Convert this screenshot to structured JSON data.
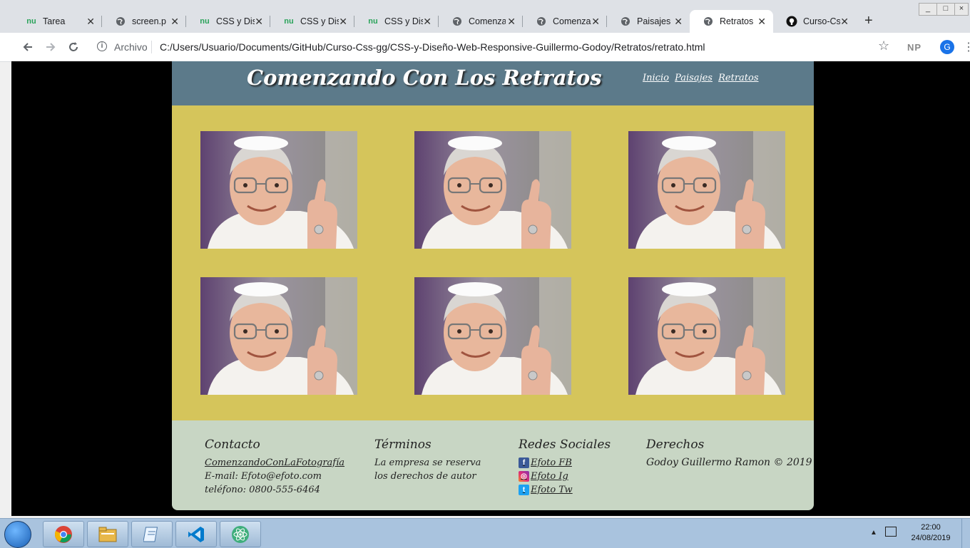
{
  "browser": {
    "tabs": [
      {
        "label": "Tarea",
        "icon": "nu-icon"
      },
      {
        "label": "screen.png",
        "icon": "globe-icon"
      },
      {
        "label": "CSS y Diseño",
        "icon": "nu-icon"
      },
      {
        "label": "CSS y Diseño",
        "icon": "nu-icon"
      },
      {
        "label": "CSS y Diseño",
        "icon": "nu-icon"
      },
      {
        "label": "Comenzando",
        "icon": "globe-icon"
      },
      {
        "label": "Comenzando",
        "icon": "globe-icon"
      },
      {
        "label": "Paisajes",
        "icon": "globe-icon"
      },
      {
        "label": "Retratos",
        "icon": "globe-icon",
        "active": true
      },
      {
        "label": "Curso-Css",
        "icon": "github-icon"
      }
    ],
    "new_tab": "+",
    "origin_label": "Archivo",
    "url": "C:/Users/Usuario/Documents/GitHub/Curso-Css-gg/CSS-y-Diseño-Web-Responsive-Guillermo-Godoy/Retratos/retrato.html",
    "extension_label": "NP",
    "profile_initial": "G"
  },
  "site": {
    "title": "Comenzando Con Los Retratos",
    "nav": [
      "Inicio",
      "Paisajes",
      "Retratos"
    ],
    "photo_count": 6,
    "footer": {
      "contact": {
        "heading": "Contacto",
        "lines": [
          "ComenzandoConLaFotografía",
          "E-mail: Efoto@efoto.com",
          "teléfono: 0800-555-6464"
        ]
      },
      "terms": {
        "heading": "Términos",
        "lines": [
          "La empresa se reserva",
          "los derechos de autor"
        ]
      },
      "social": {
        "heading": "Redes Sociales",
        "links": [
          "Efoto FB",
          "Efoto Ig",
          "Efoto Tw"
        ]
      },
      "rights": {
        "heading": "Derechos",
        "lines": [
          "Godoy Guillermo Ramon © 2019"
        ]
      }
    }
  },
  "taskbar": {
    "apps": [
      "chrome-icon",
      "file-explorer-icon",
      "notepad-icon",
      "vscode-icon",
      "atom-icon"
    ],
    "time": "22:00",
    "date": "24/08/2019"
  },
  "colors": {
    "header_bg": "#5c7a8a",
    "gallery_bg": "#d5c55b",
    "footer_bg": "#c8d6c4"
  }
}
